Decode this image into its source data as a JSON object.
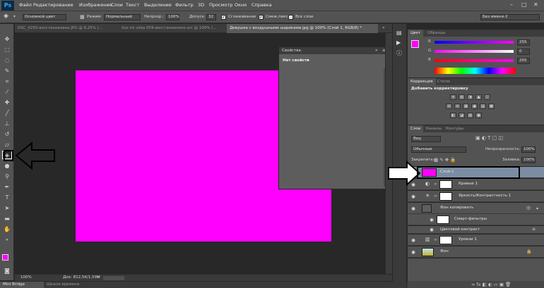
{
  "menubar": {
    "logo": "Ps",
    "items": [
      "Файл",
      "Редактирование",
      "Изображение",
      "Слои",
      "Текст",
      "Выделение",
      "Фильтр",
      "3D",
      "Просмотр",
      "Окно",
      "Справка"
    ],
    "window_controls": [
      "–",
      "□",
      "✕"
    ]
  },
  "options_bar": {
    "brush_source_value": "Основной цвет",
    "mode_label": "Режим:",
    "mode_value": "Нормальный",
    "opacity_label": "Непрозр.:",
    "opacity_value": "100%",
    "tolerance_label": "Допуск:",
    "tolerance_value": "32",
    "antialias_label": "Сглаживание",
    "contiguous_label": "Смеж.пикс",
    "all_layers_label": "Все слои",
    "workspace_value": "Без имени-2"
  },
  "doc_tabs": [
    "DSC_0250-восстановлено.JPG @ 6,25% (...",
    "Sos mi vista 059-восстановлено.avi @ 100% (...",
    "Девушка с воздушными шариками.jpg @ 100% (Слой 1, RGB/8) *"
  ],
  "status": {
    "zoom": "100%",
    "doc_info": "Док: 812,5K/1,59M"
  },
  "bottom_tabs": {
    "mini_bridge": "Mini Bridge",
    "timeline": "Шкала времени"
  },
  "properties_panel": {
    "title": "Свойства",
    "no_properties": "Нет свойств"
  },
  "color_panel": {
    "tabs": [
      "Цвет",
      "Образцы"
    ],
    "channels": [
      {
        "label": "R",
        "value": "255"
      },
      {
        "label": "G",
        "value": "0"
      },
      {
        "label": "B",
        "value": "255"
      }
    ],
    "foreground": "#ff00ff"
  },
  "adjustments_panel": {
    "tabs": [
      "Коррекция",
      "Стили"
    ],
    "heading": "Добавить корректировку",
    "icons": [
      [
        "☀",
        "▥",
        "◑",
        "▲",
        "▽"
      ],
      [
        "⊟",
        "⚖",
        "▦",
        "◕",
        "▤",
        "▩"
      ],
      [
        "◧",
        "◪",
        "▨",
        "▣"
      ]
    ]
  },
  "layers_panel": {
    "tabs": [
      "Слои",
      "Каналы",
      "Контуры"
    ],
    "filter_value": "Вид",
    "blend_value": "Обычные",
    "opacity_label": "Непрозрачность:",
    "opacity_value": "100%",
    "lock_label": "Закрепить:",
    "fill_label": "Заливка:",
    "fill_value": "100%",
    "layers": [
      {
        "name": "Слой 1",
        "color": "#ff00ff"
      },
      {
        "name": "Кривые 1",
        "color": "#ffffff"
      },
      {
        "name": "Яркость/Контрастность 1",
        "color": "#ffffff"
      },
      {
        "name": "Фон копировать",
        "color": "#5e5e5e"
      },
      {
        "name": "Смарт-фильтры",
        "color": "#ffffff"
      },
      {
        "name": "Цветовой контраст",
        "color": ""
      },
      {
        "name": "Уровни 1",
        "color": "#ffffff"
      },
      {
        "name": "Фон",
        "color": "#c4b22a"
      }
    ]
  },
  "colors": {
    "canvas": "#ff00ff",
    "ui_bg": "#535353",
    "workspace": "#282828",
    "selected_layer": "#7b8da3"
  }
}
